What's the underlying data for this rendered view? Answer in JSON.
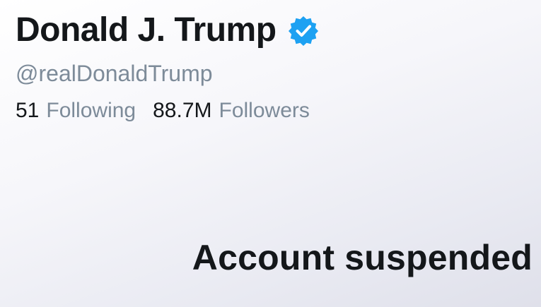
{
  "profile": {
    "display_name": "Donald J. Trump",
    "verified_icon": "verified-badge-icon",
    "handle": "@realDonaldTrump",
    "stats": {
      "following_count": "51",
      "following_label": "Following",
      "followers_count": "88.7M",
      "followers_label": "Followers"
    }
  },
  "status": {
    "message": "Account suspended"
  },
  "colors": {
    "primary_text": "#14171a",
    "secondary_text": "#7d8b99",
    "verified_blue": "#1da1f2"
  }
}
